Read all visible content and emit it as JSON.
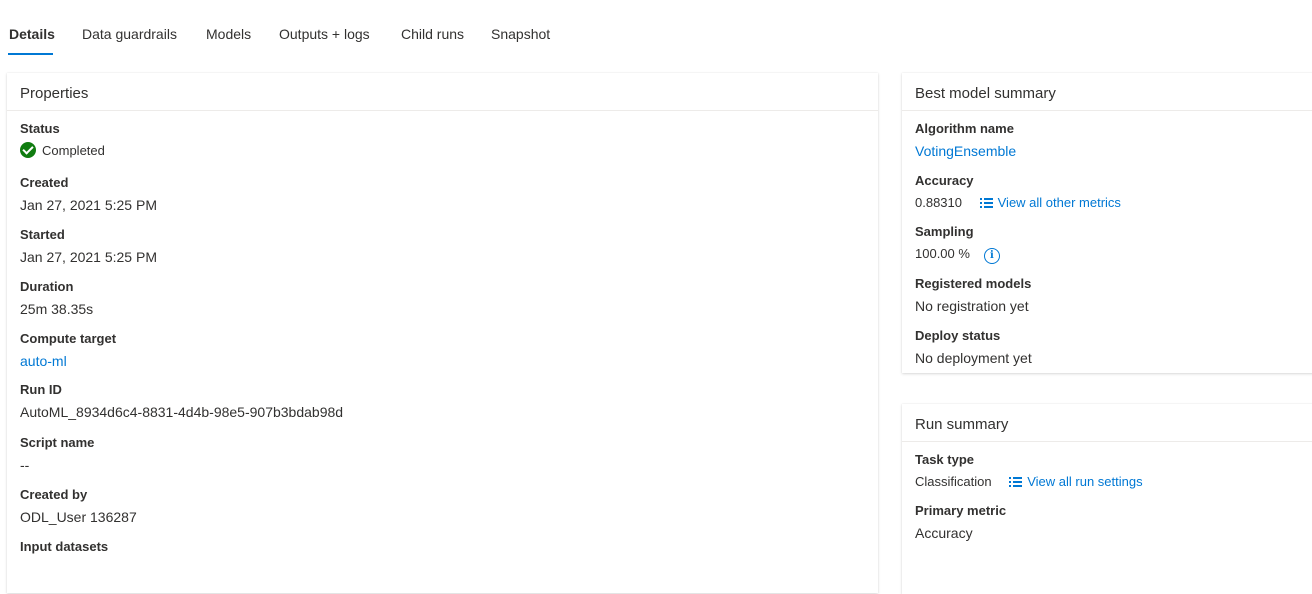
{
  "tabs": [
    "Details",
    "Data guardrails",
    "Models",
    "Outputs + logs",
    "Child runs",
    "Snapshot"
  ],
  "colors": {
    "accent": "#0078d4",
    "success": "#107c10",
    "highlight": "#ffff00"
  },
  "properties": {
    "title": "Properties",
    "status": {
      "label": "Status",
      "value": "Completed",
      "icon": "check-circle-icon"
    },
    "created": {
      "label": "Created",
      "value": "Jan 27, 2021 5:25 PM"
    },
    "started": {
      "label": "Started",
      "value": "Jan 27, 2021 5:25 PM"
    },
    "duration": {
      "label": "Duration",
      "value": "25m 38.35s"
    },
    "compute_target": {
      "label": "Compute target",
      "value": "auto-ml"
    },
    "run_id": {
      "label": "Run ID",
      "value": "AutoML_8934d6c4-8831-4d4b-98e5-907b3bdab98d"
    },
    "script_name": {
      "label": "Script name",
      "value": "--"
    },
    "created_by": {
      "label": "Created by",
      "value": "ODL_User 136287"
    },
    "input_datasets": {
      "label": "Input datasets"
    }
  },
  "best_model": {
    "title": "Best model summary",
    "algorithm": {
      "label": "Algorithm name",
      "value": "VotingEnsemble"
    },
    "accuracy": {
      "label": "Accuracy",
      "value": "0.88310",
      "link": "View all other metrics",
      "icon": "list-icon"
    },
    "sampling": {
      "label": "Sampling",
      "value": "100.00 %",
      "icon": "info-icon"
    },
    "registered": {
      "label": "Registered models",
      "value": "No registration yet"
    },
    "deploy": {
      "label": "Deploy status",
      "value": "No deployment yet"
    }
  },
  "run_summary": {
    "title": "Run summary",
    "task_type": {
      "label": "Task type",
      "value": "Classification",
      "link": "View all run settings",
      "icon": "list-icon"
    },
    "primary_metric": {
      "label": "Primary metric",
      "value": "Accuracy"
    }
  }
}
